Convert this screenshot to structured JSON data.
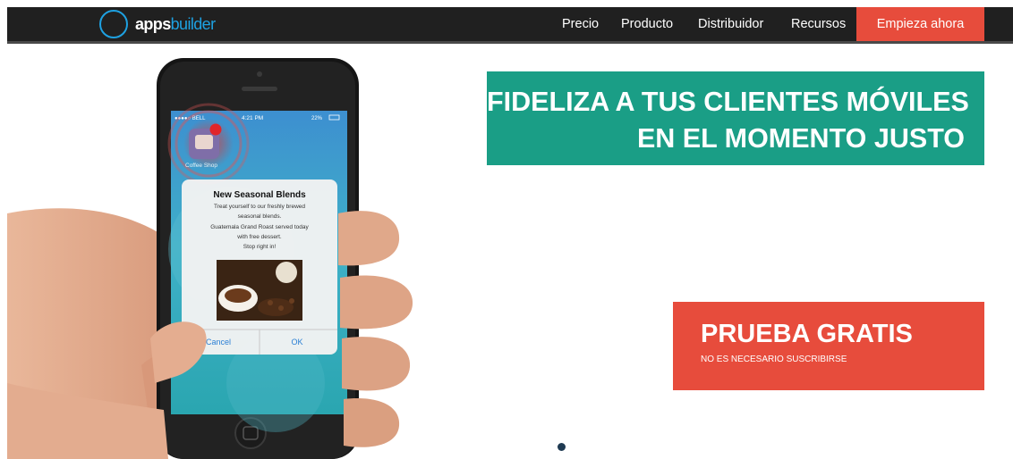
{
  "brand": {
    "apps": "apps",
    "builder": "builder"
  },
  "nav": {
    "items": [
      "Precio",
      "Producto",
      "Distribuidor",
      "Recursos"
    ],
    "cta": "Empieza ahora"
  },
  "phone": {
    "carrier": "●●●●○ BELL",
    "time": "4:21 PM",
    "battery": "22%",
    "app_label": "Coffee Shop",
    "notification": {
      "title": "New Seasonal Blends",
      "lines": [
        "Treat yourself to our freshly brewed",
        "seasonal blends.",
        "Guatemala Grand Roast served today",
        "with free dessert.",
        "Stop right in!"
      ],
      "cancel": "Cancel",
      "ok": "OK"
    }
  },
  "headline": {
    "line1": "FIDELIZA A TUS CLIENTES MÓVILES",
    "line2": "EN EL MOMENTO JUSTO"
  },
  "trial": {
    "title": "PRUEBA GRATIS",
    "subtitle": "NO ES NECESARIO SUSCRIBIRSE"
  },
  "colors": {
    "nav_bg": "#202020",
    "cta_red": "#e74c3c",
    "headline_green": "#1a9e86",
    "brand_blue": "#1ea1e1"
  }
}
